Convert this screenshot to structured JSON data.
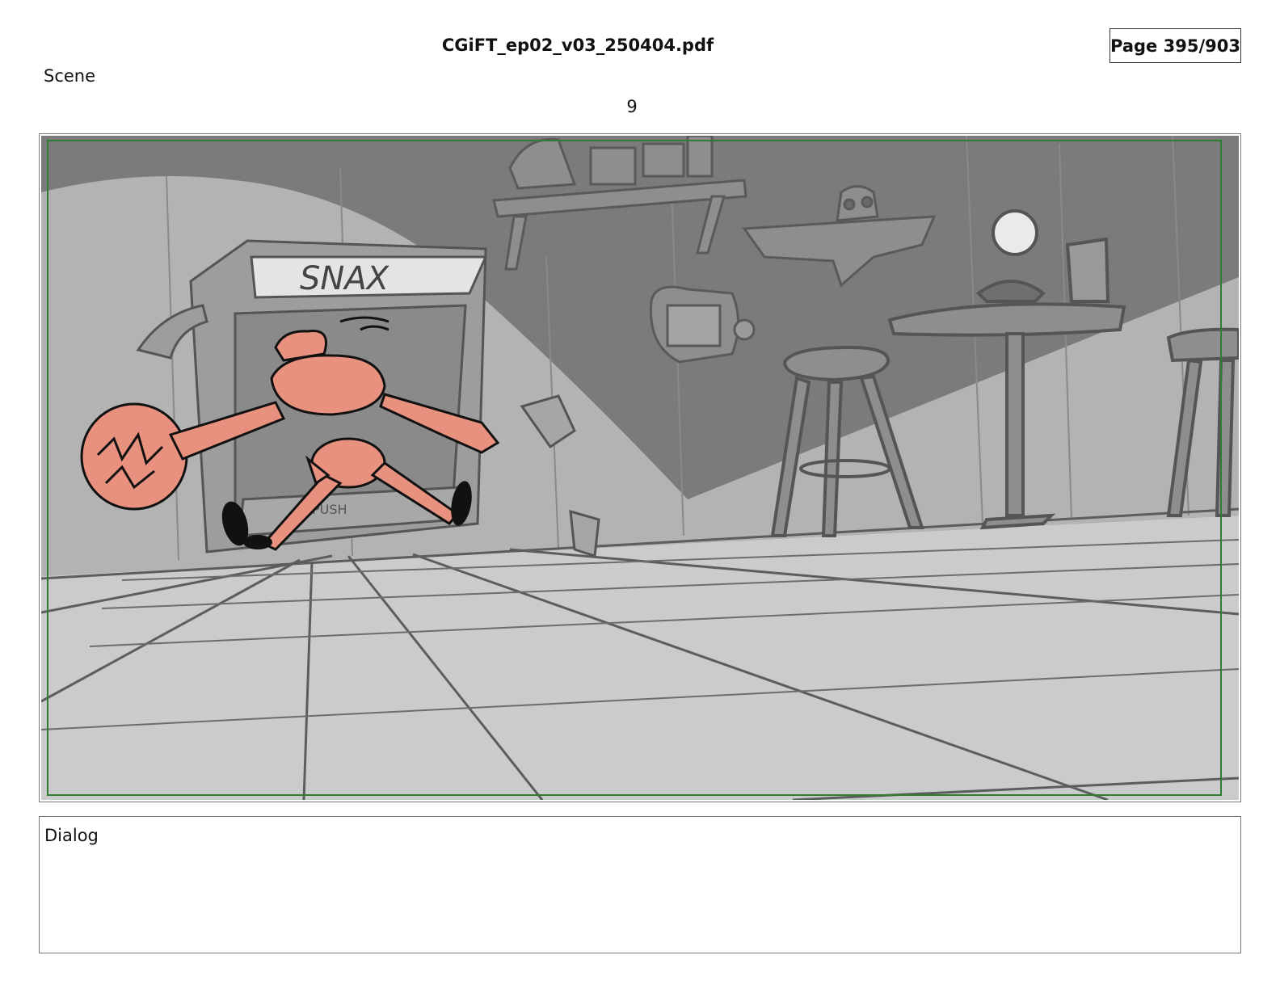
{
  "header": {
    "file_title": "CGiFT_ep02_v03_250404.pdf",
    "page_indicator": "Page 395/903"
  },
  "scene": {
    "label": "Scene",
    "number": "9"
  },
  "panel": {
    "sign_text": "SNAX",
    "push_text": "PUSH",
    "colors": {
      "wall_dark": "#7b7b7b",
      "wall_light": "#b3b3b3",
      "floor": "#cbcbcb",
      "line": "#5a5a5a",
      "character": "#e8917e",
      "safe_frame": "#2e7d32"
    }
  },
  "dialog": {
    "label": "Dialog"
  }
}
